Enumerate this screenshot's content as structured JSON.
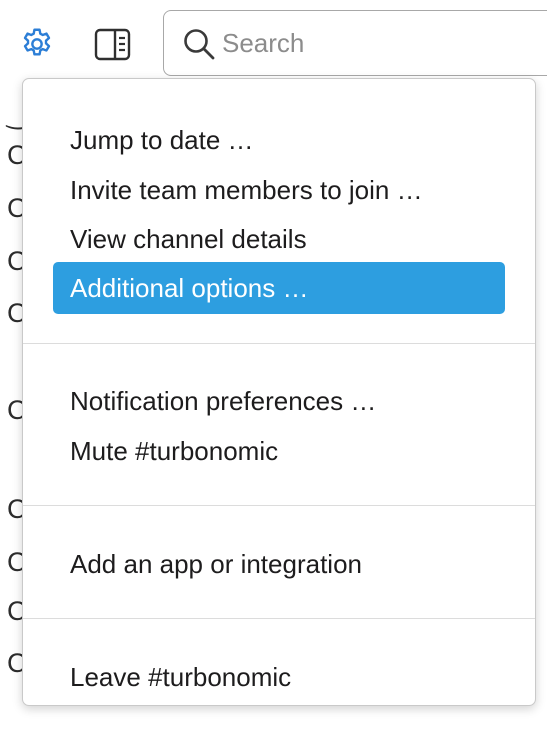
{
  "toolbar": {
    "settings_icon": "gear-icon",
    "details_icon": "sidebar-panel-icon",
    "search_icon": "search-icon",
    "accent_color": "#2c7ed6"
  },
  "search": {
    "placeholder": "Search",
    "value": ""
  },
  "background": {
    "row_glyphs": [
      "C",
      "C",
      "C",
      "C",
      "C",
      "C",
      "C",
      "C",
      "C"
    ]
  },
  "menu": {
    "highlight_color": "#2d9ee0",
    "sections": [
      {
        "items": [
          {
            "label": "Jump to date …",
            "active": false
          },
          {
            "label": "Invite team members to join …",
            "active": false
          },
          {
            "label": "View channel details",
            "active": false
          },
          {
            "label": "Additional options …",
            "active": true
          }
        ]
      },
      {
        "items": [
          {
            "label": "Notification preferences …",
            "active": false
          },
          {
            "label": "Mute #turbonomic",
            "active": false
          }
        ]
      },
      {
        "items": [
          {
            "label": "Add an app or integration",
            "active": false
          }
        ]
      },
      {
        "items": [
          {
            "label": "Leave #turbonomic",
            "active": false
          }
        ]
      }
    ]
  }
}
